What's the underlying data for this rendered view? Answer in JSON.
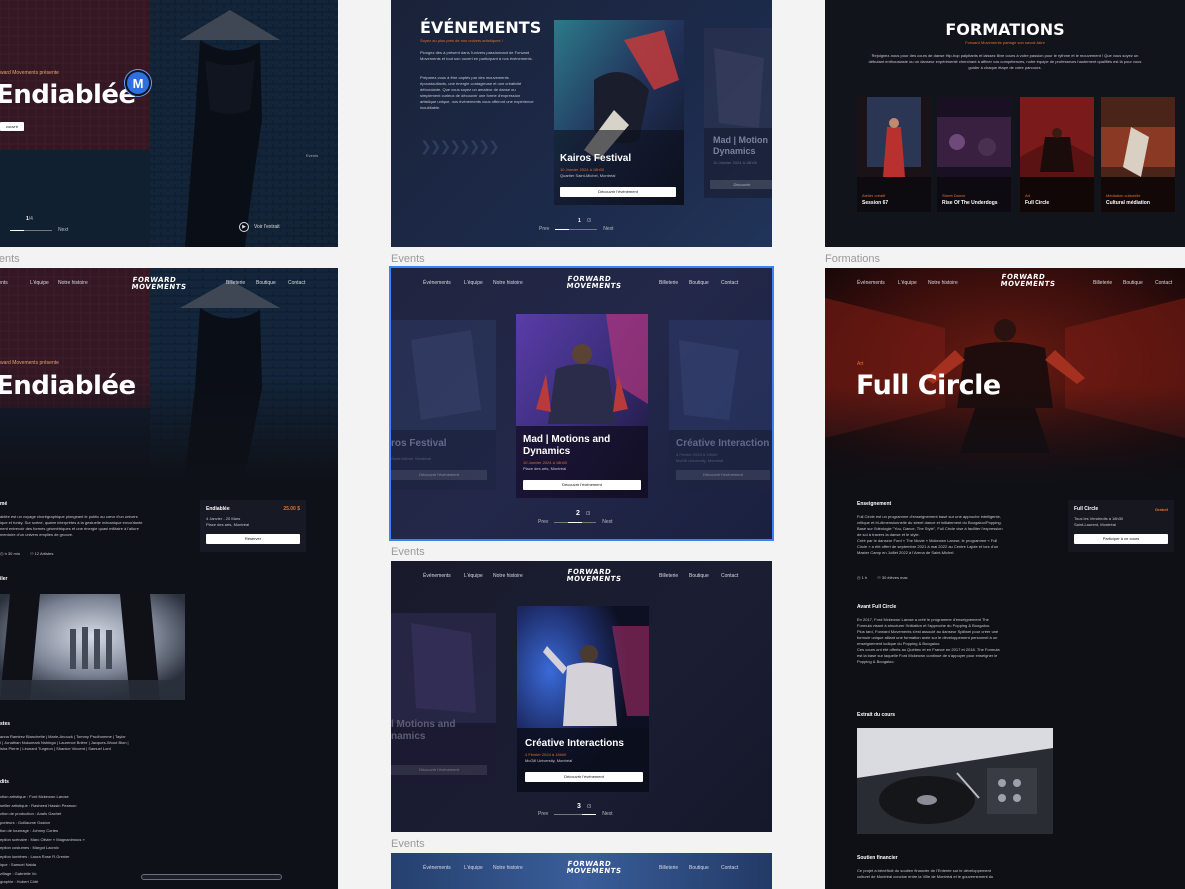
{
  "labels": {
    "events_1": "Events",
    "formations": "Formations",
    "events_2": "Events",
    "events_3": "Events",
    "events_4": "Events"
  },
  "colors": {
    "accent": "#e2702e",
    "selection": "#3b82f6",
    "avatar": "#2f6fe0",
    "bg": "#0d0f16"
  },
  "hero1": {
    "presents": "ward Movements présente",
    "title": "Endiablée",
    "button": "couvrir",
    "pager_num": "1",
    "pager_den": "/4",
    "next": "Next",
    "watch": "Voir l'extrait",
    "events_tag": "Events",
    "avatar_letter": "M"
  },
  "events": {
    "heading": "ÉVÉNEMENTS",
    "subtitle": "Soyez au plus près de nos univers artistiques !",
    "para1": "Plongez dès à présent dans l'univers passionnant de Forward Movements et tout son ouvert en participant à nos événements.",
    "para2": "Préparez-vous à être captés par des mouvements époustouflants, une énergie contagieuse et une créativité débordante. Que vous soyez un amateur de danse ou simplement curieux de découvrir une forme d'expression artistique unique, nos événements vous offriront une expérience inoubliable.",
    "card1": {
      "title": "Kairos Festival",
      "date": "10 Janvier 2024 à 18h00",
      "place": "Quartier Saint-Michel, Montréal",
      "button": "Découvrir l'événement"
    },
    "card2": {
      "title": "Mad | Motion Dynamics",
      "date": "10 Janvier 2024 à 18h00",
      "place": "Place des arts, Montréal",
      "button": "Découvrir"
    },
    "pager_num": "1",
    "pager_den": "/3",
    "prev": "Prev",
    "next": "Next"
  },
  "formations": {
    "heading": "FORMATIONS",
    "subtitle": "Forward Movements partage son savoir-faire",
    "para": "Rejoignez-nous pour des cours de danse Hip-hop palpitants et laissez libre cours à votre passion pour le rythme et le mouvement ! Que vous soyez un débutant enthousiaste ou un danseur expérimenté cherchant à affiner vos compétences, notre équipe de professeurs hautement qualifiés est là pour vous guider à chaque étape de votre parcours.",
    "cards": [
      {
        "tag": "Atelier créatif",
        "title": "Session 67"
      },
      {
        "tag": "Street Dance",
        "title": "Rise Of The Underdogs"
      },
      {
        "tag": "Art",
        "title": "Full Circle"
      },
      {
        "tag": "Médiation culturelle",
        "title": "Cultural médiation"
      }
    ]
  },
  "nav": {
    "evenements": "Événements",
    "equipe": "L'équipe",
    "histoire": "Notre histoire",
    "billeterie": "Billeterie",
    "boutique": "Boutique",
    "contact": "Contact",
    "logo_line1": "FORWARD",
    "logo_line2": "MOVEMENTS"
  },
  "detail": {
    "presents": "ward Movements présente",
    "title": "Endiablée",
    "resume_h": "mé",
    "resume": [
      "ablée est un voyage chorégraphique plongeant le public au cœur d'un univers",
      "ique et funky. Sur scène, quatre interprètes à la gestuelle mécanique envoûtante",
      "nent entrevoir des formes géométriques et une énergie quasi militaire à l'allure",
      "mentoire d'un univers emplies de groove."
    ],
    "duration": "h 30 min",
    "artists": "12 Artistes",
    "ticket_title": "Endiablée",
    "ticket_price": "25.00 $",
    "ticket_dates": "4 Janvier - 20 Mars",
    "ticket_place": "Place des arts, Montréal",
    "ticket_button": "Réserver",
    "trailer_h": "iler",
    "artistes_h": "stes",
    "artistes": [
      "anna Ramirez Blanchette | Marie-Anouck | Tommy Prudhomme | Taylor",
      "l | Jonathan Nukumark Nshinga | Laurence Brière | Jacques-Wood Bion |",
      "isha Pierre | Léonard Turgeon | Shanice Vincent | Samuel Lord"
    ],
    "credits_h": "dits",
    "credits": [
      "ction artistique : Ford Mckeown Larose",
      "seiller artistique : Rasheed Hassin Pearson",
      "ction de production : Anaïs Gachet",
      "porteurs : Guillaume Gaston",
      "tion de tournage : Johnny Cortes",
      "eption scénaire : Marc Olivier « Magnanimous »",
      "eption costumes : Margot Lacroix",
      "eption lumières : Laura Rose R.Grenier",
      "ique : Samuel Naida",
      "zillage : Gabrielle Vo",
      "graphie : Hubert Côté"
    ]
  },
  "carousel2": {
    "left": {
      "title": "ros Festival",
      "sub": "Saint-Michel, Montréal",
      "button": "Découvrir l'événement"
    },
    "center": {
      "title": "Mad | Motions and Dynamics",
      "date": "10 Janvier 2024 à 18h00",
      "place": "Place des arts, Montréal",
      "button": "Découvrir l'événement"
    },
    "right": {
      "title": "Créative Interaction",
      "date": "4 Février 2024 à 18h00",
      "place": "McGill University, Montréal",
      "button": "Découvrir l'événement"
    },
    "pager_num": "2",
    "pager_den": "/3",
    "prev": "Prev",
    "next": "Next"
  },
  "carousel3": {
    "left": {
      "title": "l Motions and namics",
      "button": "Découvrir l'événement"
    },
    "center": {
      "title": "Créative Interactions",
      "date": "4 Février 2024 à 18h00",
      "place": "McGill University, Montréal",
      "button": "Découvrir l'événement"
    },
    "pager_num": "3",
    "pager_den": "/3",
    "prev": "Prev",
    "next": "Next"
  },
  "fullcircle": {
    "tag": "Art",
    "title": "Full Circle",
    "ens_h": "Enseignement",
    "ens": [
      "Full Circle est un programme d'enseignement basé sur une approche intelligente,",
      "critique et tri-dimensionnelle du street dance et initialement du Boogaloo/Popping.",
      "Basé sur l'idéologie \"You, Dance, The Style\", Full Circle vise à faciliter l'expression",
      "de soi à travers la danse et le style.",
      "Créé par le danseur Ford « The Movie » Mckeown Larose, le programme « Full",
      "Circle » a été offert de septembre 2021 à mai 2022 au Centre Lajoie et lors d'un",
      "Master Camp en Juillet 2022 à l'Arena de Saint-Michel."
    ],
    "hours": "1 h",
    "students": "30 élèves max",
    "card_title": "Full Circle",
    "card_price": "Gratuit",
    "card_when": "Tous les Vendredis à 18h30",
    "card_place": "Saint-Laurent, Montréal",
    "card_button": "Participer à ce cours",
    "avant_h": "Avant Full Circle",
    "avant": [
      "En 2017, Ford Mckeown Larose a créé le programme d'enseignement The",
      "Formula visant à structurer l'initiation et l'approche du Popping & Boogaloo.",
      "Plus tard, Forward Movements s'est associé au danseur Spillwel pour créer une",
      "formule unique alliant une formation axée sur le développement personnel à un",
      "enseignement ludique du Popping & Boogaloo.",
      "Ces cours ont été offerts au Québec et en France en 2017 et 2018. The Formula",
      "est la base sur laquelle Ford Mckeown continue de s'appuyer pour enseigner le",
      "Popping & Boogaloo."
    ],
    "extrait_h": "Extrait du cours",
    "soutien_h": "Soutien financier",
    "soutien": [
      "Ce projet a bénéficié du soutien financier de l'Entente sur le développement",
      "culturel de Montréal conclue entre la Ville de Montréal et le gouvernement du"
    ]
  }
}
